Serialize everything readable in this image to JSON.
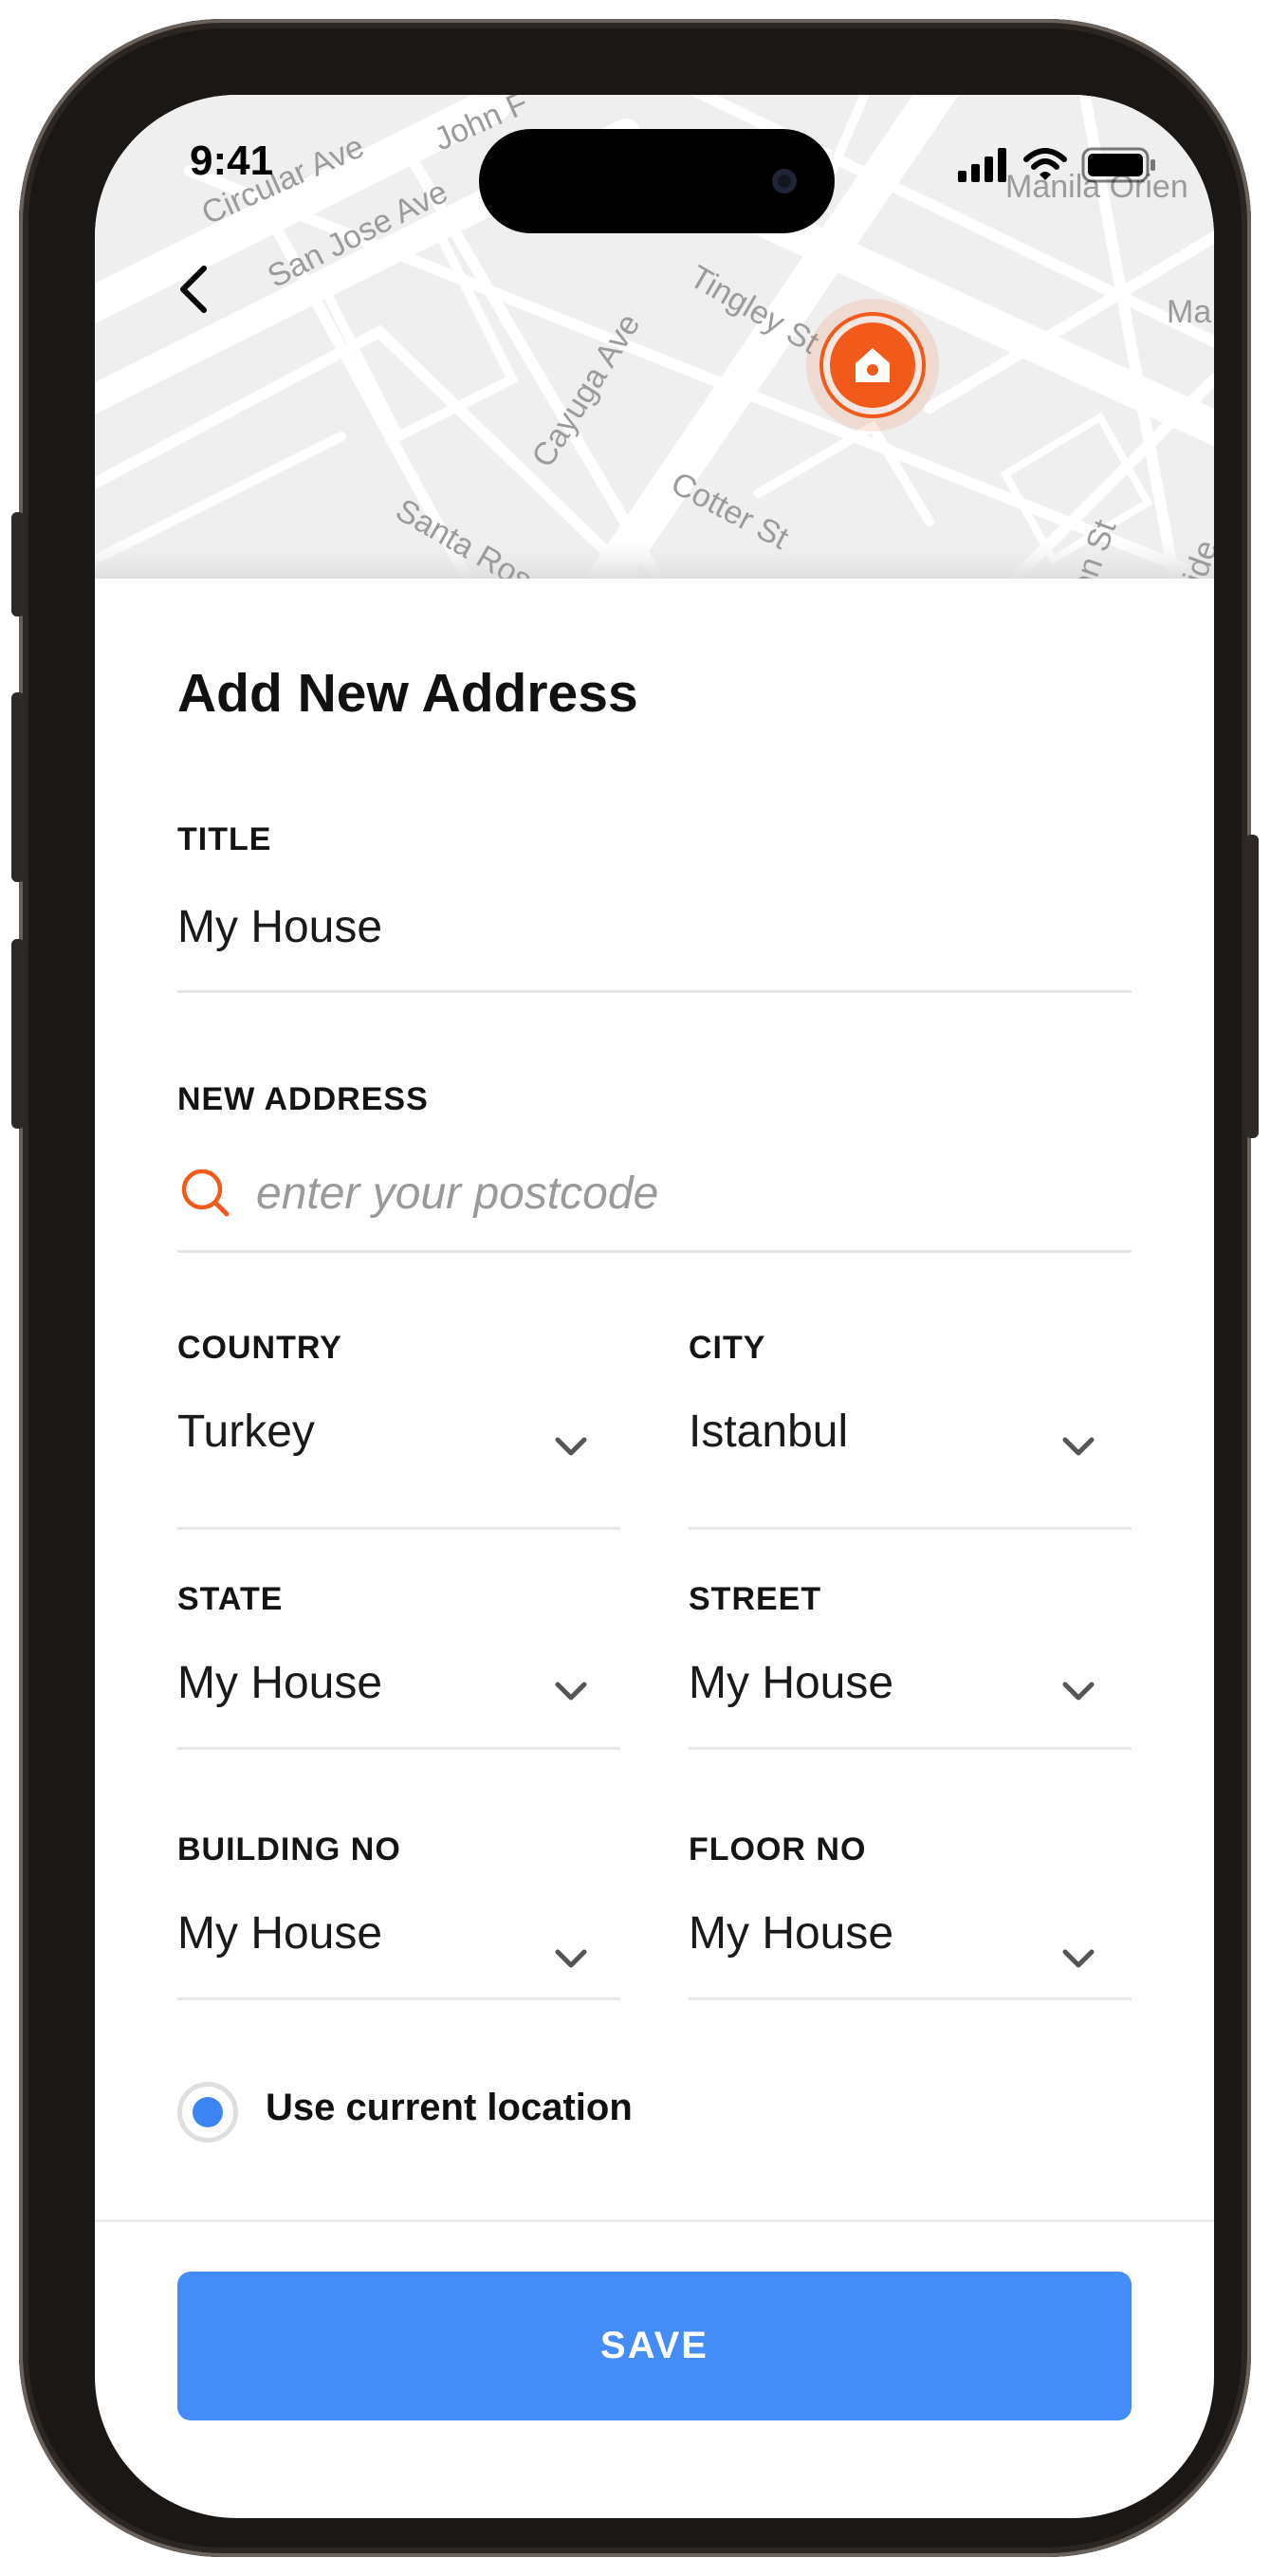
{
  "status_bar": {
    "time": "9:41"
  },
  "map": {
    "streets": [
      "Circular Ave",
      "John F",
      "San Jose Ave",
      "Tingley St",
      "Cayuga Ave",
      "Cotter St",
      "Santa Rosa",
      "Manila Orien",
      "Ma",
      "on St",
      "ride"
    ],
    "pin_icon": "home-pin-icon",
    "pin_color": "#f15a1a"
  },
  "header": {
    "back_icon": "chevron-left-icon"
  },
  "form": {
    "title": "Add New Address",
    "title_field": {
      "label": "TITLE",
      "value": "My House"
    },
    "new_address": {
      "label": "NEW ADDRESS",
      "placeholder": "enter your postcode",
      "icon": "search-icon"
    },
    "country": {
      "label": "COUNTRY",
      "value": "Turkey"
    },
    "city": {
      "label": "CITY",
      "value": "Istanbul"
    },
    "state": {
      "label": "STATE",
      "value": "My House"
    },
    "street": {
      "label": "STREET",
      "value": "My House"
    },
    "building_no": {
      "label": "BUILDING NO",
      "value": "My House"
    },
    "floor_no": {
      "label": "FLOOR NO",
      "value": "My House"
    },
    "use_current_location": {
      "label": "Use current location",
      "selected": true
    }
  },
  "actions": {
    "save_label": "SAVE"
  },
  "colors": {
    "accent": "#448cf7",
    "brand": "#f15a1a",
    "divider": "#e6e6e6"
  }
}
